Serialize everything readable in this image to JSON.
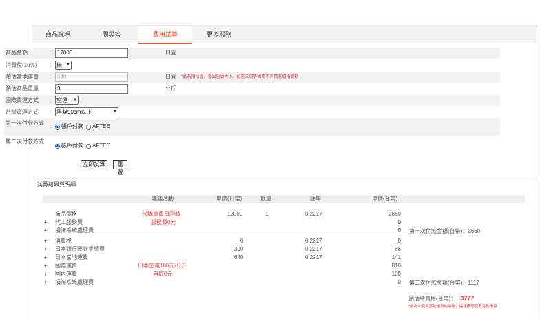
{
  "tabs": [
    {
      "label": "商品說明"
    },
    {
      "label": "問與答"
    },
    {
      "label": "費用試算"
    },
    {
      "label": "更多服務"
    }
  ],
  "form": {
    "price": {
      "label": "商品金額",
      "value": "12000",
      "unit": "日圓"
    },
    "tax": {
      "label": "消費稅(10%)",
      "value": "無"
    },
    "domestic_shipping": {
      "label": "預估當地運費",
      "placeholder": "640",
      "unit": "日圓",
      "note": "*此為預估值，會因包裹大小、配送公司等因素不同而有價格變動"
    },
    "weight": {
      "label": "預估商品重量",
      "value": "3",
      "unit": "公斤"
    },
    "intl_method": {
      "label": "國際貨運方式",
      "value": "空運"
    },
    "tw_method": {
      "label": "台灣貨運方式",
      "value": "黑貓90cm以下"
    },
    "first_payment": {
      "label": "第一次付款方式",
      "options": [
        "帳戶付款",
        "AFTEE"
      ]
    },
    "second_payment": {
      "label": "第二次付款方式",
      "options": [
        "帳戶付款",
        "AFTEE"
      ]
    },
    "calc_button": "立即試算",
    "reset_button": "重置"
  },
  "results": {
    "title": "試算結果與明細",
    "headers": {
      "activity": "建議活動",
      "unit_price": "單價(日幣)",
      "qty": "數量",
      "rate": "匯率",
      "unit_price_twd": "單價(台幣)"
    },
    "rows": [
      {
        "name": "商品價格",
        "activity": "代購會員日回饋",
        "jpy": "12000",
        "qty": "1",
        "rate": "0.2217",
        "twd": "2660"
      },
      {
        "name": "代工服務費",
        "activity": "服務費0元",
        "twd": "0"
      },
      {
        "name": "損淘系統處理費",
        "twd": "0"
      },
      {
        "name": "消費稅",
        "jpy": "0",
        "rate": "0.2217",
        "twd": "0"
      },
      {
        "name": "日本銀行匯款手續費",
        "jpy": "300",
        "rate": "0.2217",
        "twd": "66"
      },
      {
        "name": "日本當地運費",
        "jpy": "640",
        "rate": "0.2217",
        "twd": "141"
      },
      {
        "name": "國際運費",
        "activity": "日本空運180元/公斤",
        "twd": "810"
      },
      {
        "name": "國內運費",
        "activity": "自取0元",
        "twd": "100"
      },
      {
        "name": "損淘系統處理費",
        "twd": "0"
      }
    ],
    "first_total": "第一次付款金額(台幣)：2660",
    "second_total": "第二次付款金額(台幣)：1117",
    "grand_total_label": "預估總費用(台幣)：",
    "grand_total_value": "3777",
    "grand_total_note": "*此為未使用活動優惠的價格，建議搭配使用活動優惠"
  }
}
